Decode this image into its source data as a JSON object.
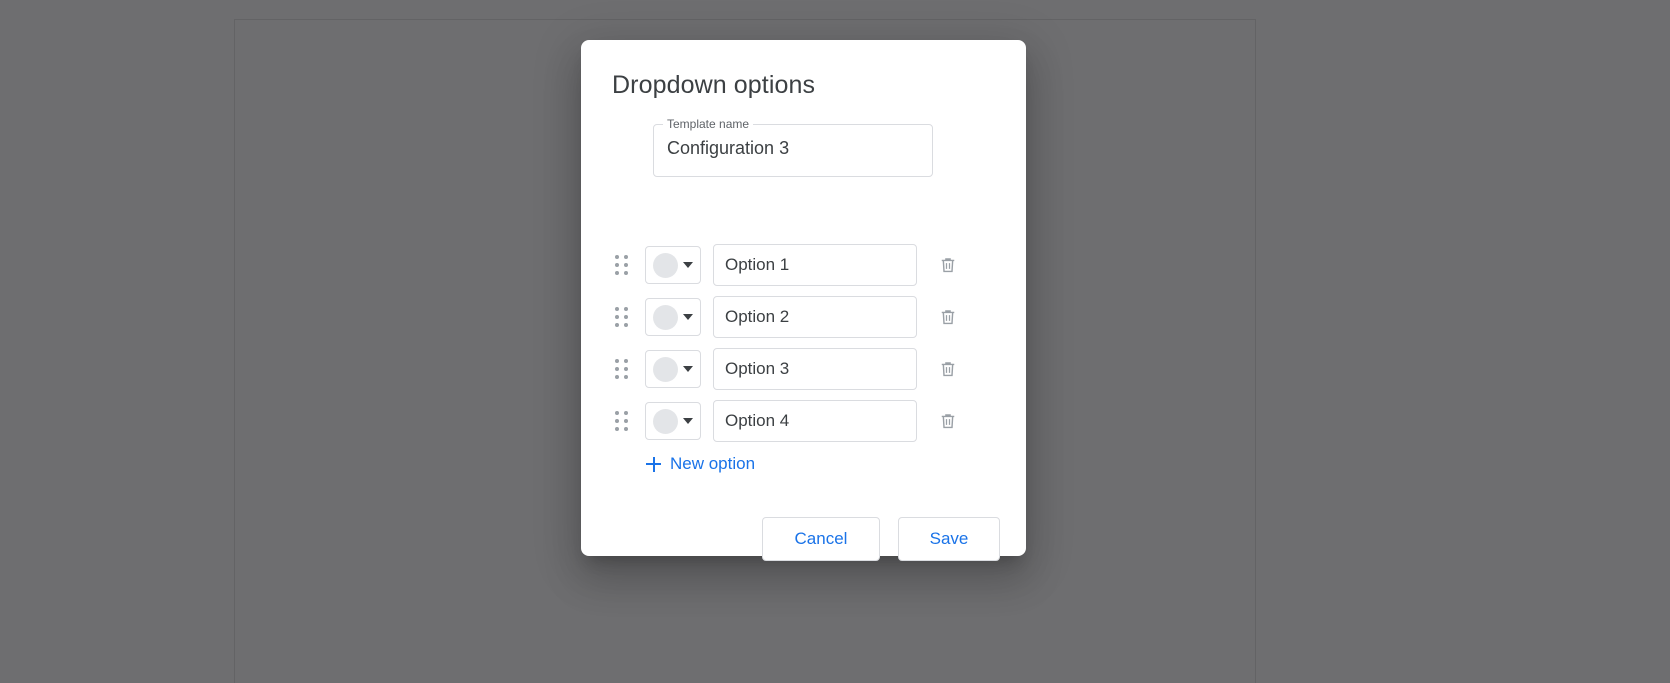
{
  "dialog": {
    "title": "Dropdown options",
    "template_field": {
      "label": "Template name",
      "value": "Configuration 3"
    },
    "options": [
      {
        "swatch_color": "#e3e5e8",
        "value": "Option 1",
        "delete_label": "Delete option 1"
      },
      {
        "swatch_color": "#e3e5e8",
        "value": "Option 2",
        "delete_label": "Delete option 2"
      },
      {
        "swatch_color": "#e3e5e8",
        "value": "Option 3",
        "delete_label": "Delete option 3"
      },
      {
        "swatch_color": "#e3e5e8",
        "value": "Option 4",
        "delete_label": "Delete option 4"
      }
    ],
    "new_option_label": "New option",
    "cancel_label": "Cancel",
    "save_label": "Save"
  },
  "icons": {
    "drag_handle": "drag-handle-icon",
    "dropdown_caret": "chevron-down-icon",
    "delete": "trash-icon",
    "plus": "plus-icon"
  },
  "colors": {
    "accent": "#1a73e8",
    "scrim": "rgba(32,33,36,0.65)",
    "border": "#dadce0",
    "icon_gray": "#9aa0a6",
    "text": "#3c4043"
  }
}
